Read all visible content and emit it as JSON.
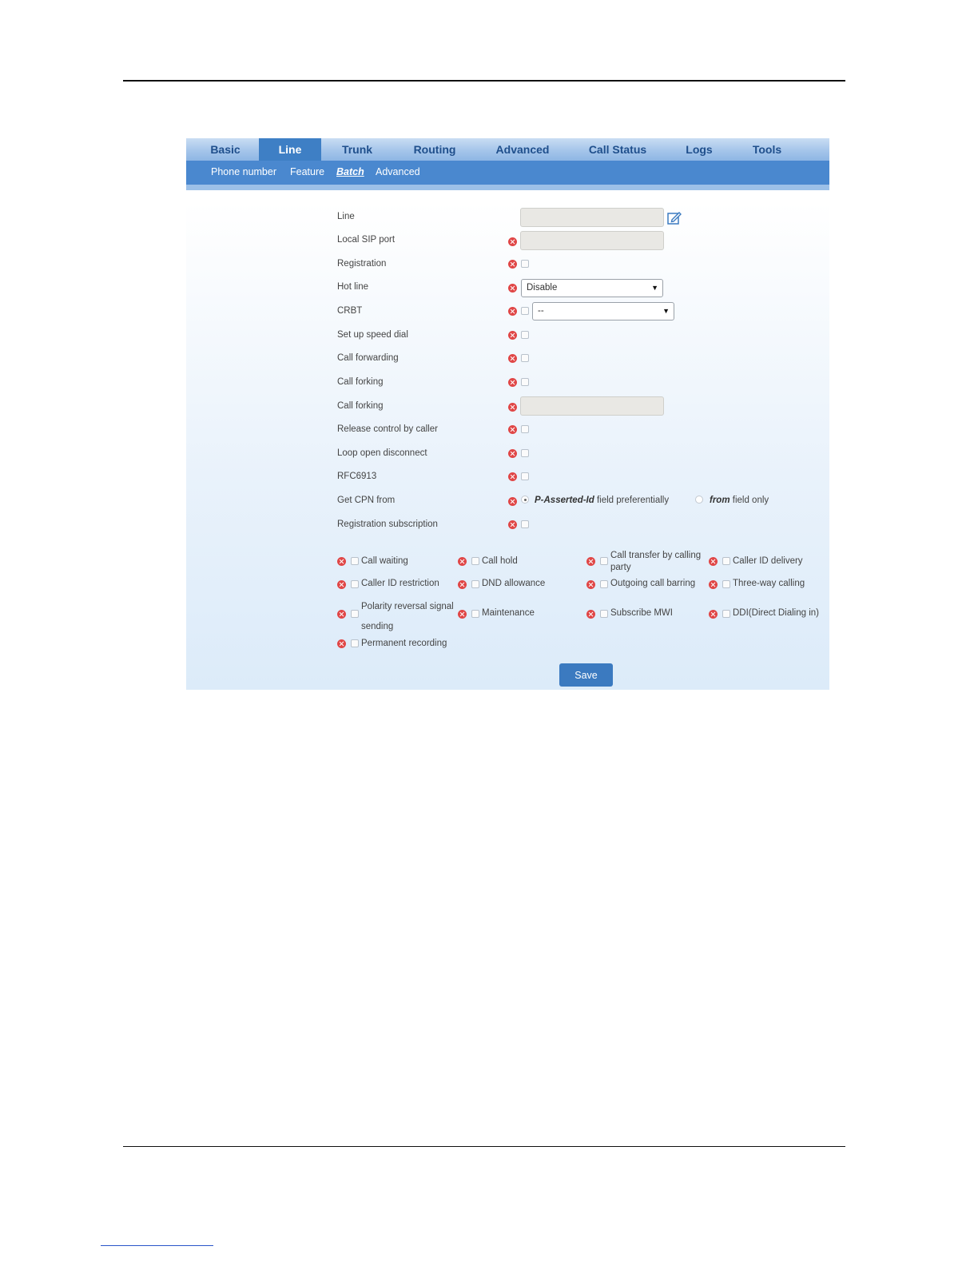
{
  "nav": {
    "main_tabs": [
      "Basic",
      "Line",
      "Trunk",
      "Routing",
      "Advanced",
      "Call Status",
      "Logs",
      "Tools"
    ],
    "active_main": "Line",
    "sub_tabs": [
      "Phone number",
      "Feature",
      "Batch",
      "Advanced"
    ],
    "active_sub": "Batch"
  },
  "form": {
    "rows": [
      "Line",
      "Local SIP port",
      "Registration",
      "Hot line",
      "CRBT",
      "Set up speed dial",
      "Call forwarding",
      "Call forking",
      "Call forking",
      "Release control by caller",
      "Loop open disconnect",
      "RFC6913",
      "Get CPN from",
      "Registration subscription"
    ],
    "hotline_value": "Disable",
    "crbt_value": "--",
    "cpn_option1_em": "P-Asserted-Id",
    "cpn_option1_rest": " field preferentially",
    "cpn_option2_em": "from",
    "cpn_option2_rest": " field only",
    "cpn_selected": "option1"
  },
  "features": [
    "Call waiting",
    "Call hold",
    "Call transfer by calling party",
    "Caller ID delivery",
    "Caller ID restriction",
    "DND allowance",
    "Outgoing call barring",
    "Three-way calling",
    "Polarity reversal signal sending",
    "Maintenance",
    "Subscribe MWI",
    "DDI(Direct Dialing in)",
    "Permanent recording"
  ],
  "save_label": "Save",
  "colors": {
    "nav_active": "#3e7fc5",
    "subnav_bg": "#4a88cf",
    "error_icon": "#e04646",
    "save_button": "#3b7ac0"
  }
}
